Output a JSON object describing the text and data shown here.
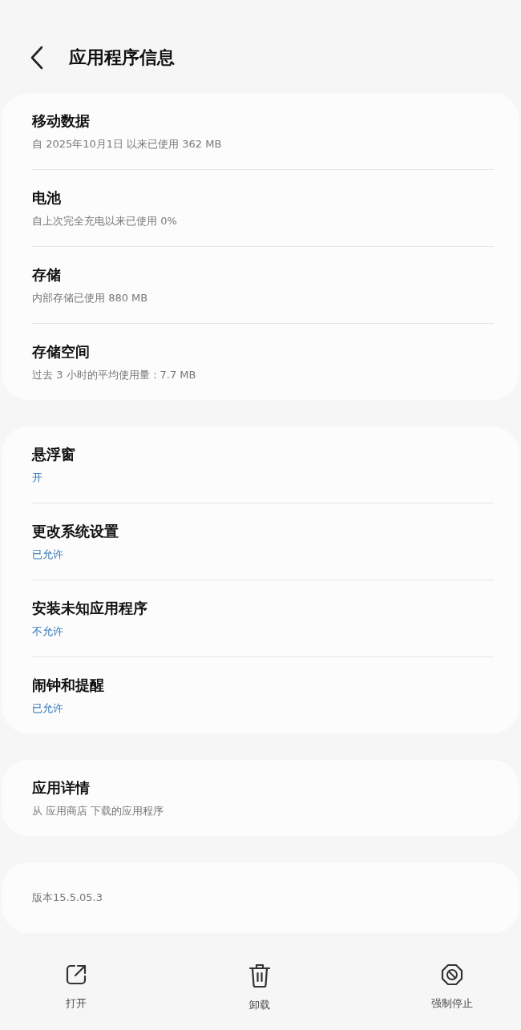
{
  "header": {
    "title": "应用程序信息"
  },
  "sections": [
    {
      "rows": [
        {
          "kind": "info",
          "title": "移动数据",
          "detail": "自 2025年10月1日 以来已使用 362 MB"
        },
        {
          "kind": "info",
          "title": "电池",
          "detail": "自上次完全充电以来已使用 0%"
        },
        {
          "kind": "info",
          "title": "存储",
          "detail": "内部存储已使用 880 MB"
        },
        {
          "kind": "info",
          "title": "存储空间",
          "detail": "过去 3 小时的平均使用量：7.7 MB"
        }
      ]
    },
    {
      "rows": [
        {
          "kind": "setting",
          "title": "悬浮窗",
          "detail": "开"
        },
        {
          "kind": "setting",
          "title": "更改系统设置",
          "detail": "已允许"
        },
        {
          "kind": "setting",
          "title": "安装未知应用程序",
          "detail": "不允许"
        },
        {
          "kind": "setting",
          "title": "闹钟和提醒",
          "detail": "已允许"
        }
      ]
    },
    {
      "rows": [
        {
          "kind": "info",
          "title": "应用详情",
          "detail": "从 应用商店 下载的应用程序"
        }
      ]
    },
    {
      "rows": [
        {
          "kind": "version",
          "detail": "版本15.5.05.3"
        }
      ]
    }
  ],
  "actions": [
    {
      "kind": "open",
      "label": "打开"
    },
    {
      "kind": "uninstall",
      "label": "卸载"
    },
    {
      "kind": "stop",
      "label": "强制停止"
    }
  ]
}
